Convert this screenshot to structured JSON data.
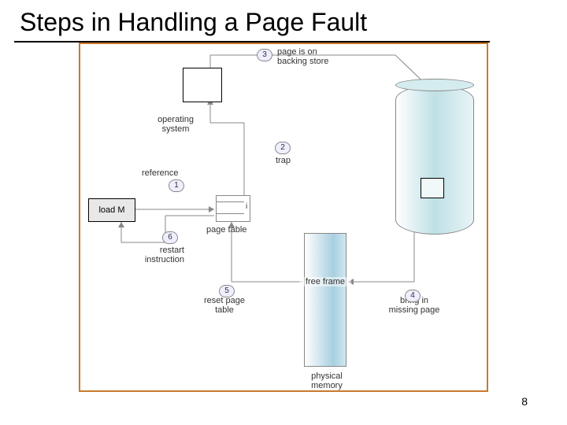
{
  "title": "Steps in Handling a Page Fault",
  "page_number": "8",
  "labels": {
    "operating_system": "operating\nsystem",
    "reference": "reference",
    "load_m": "load M",
    "restart_instruction": "restart\ninstruction",
    "page_table": "page table",
    "trap": "trap",
    "page_on_store": "page is on\nbacking store",
    "i_flag": "i",
    "free_frame": "free frame",
    "reset_page_table": "reset page\ntable",
    "bring_in_missing": "bring in\nmissing page",
    "physical_memory": "physical\nmemory"
  },
  "steps": {
    "1": "1",
    "2": "2",
    "3": "3",
    "4": "4",
    "5": "5",
    "6": "6"
  }
}
